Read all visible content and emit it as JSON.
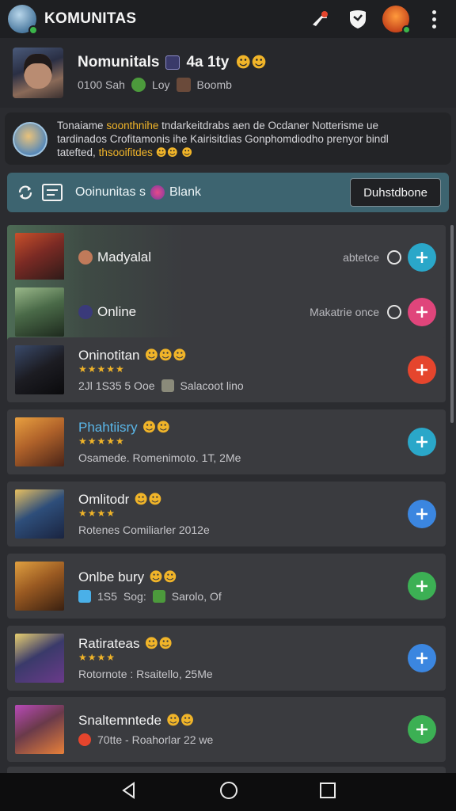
{
  "app": {
    "title": "KOMUNITAS"
  },
  "appbar": {
    "icons": [
      "app-logo",
      "share-icon",
      "shield-icon",
      "user-avatar",
      "more-vertical-icon"
    ]
  },
  "profile": {
    "name": "Nomunitals",
    "name_suffix": "4a 1ty",
    "meta_left": "0100 Sah",
    "meta_mid": "Loy",
    "meta_right": "Boomb"
  },
  "notice": {
    "line1_a": "Tonaiame",
    "line1_hl": "soonthnihe",
    "line1_b": "tndarkeitdrabs aen de Ocdaner Notterisme ue",
    "line2": "tardinados Crofitamonis ihe Kairisitdias Gonphomdiodho prenyor bindl",
    "line3_a": "tatefted,",
    "line3_hl": "thsooifitdes"
  },
  "filter": {
    "label": "Ooinunitas s",
    "label_suffix": "Blank",
    "button": "Duhstdbone"
  },
  "colors": {
    "accent_cyan": "#2aa7c9",
    "accent_pink": "#e0457b",
    "accent_red": "#e5452d",
    "accent_blue": "#3b86e0",
    "accent_green": "#3cb054",
    "star": "#f0b429"
  },
  "rows": [
    {
      "title": "Madyalal",
      "sub": "",
      "status": "abtetce",
      "button_color": "#2aa7c9",
      "thumb": "#7a2a24"
    },
    {
      "title": "Online",
      "sub": "",
      "status": "Makatrie once",
      "button_color": "#e0457b",
      "thumb": "#4a6a48"
    },
    {
      "title": "Oninotitan",
      "stars": "★★★★★",
      "sub_a": "2Jl 1S35 5 Ooe",
      "sub_b": "Salacoot lino",
      "button_color": "#e5452d",
      "thumb": "#1c1c22"
    },
    {
      "title": "Phahtiisry",
      "stars": "★★★★★",
      "sub_a": "Osamede. Romenimoto. 1T, 2Me",
      "button_color": "#2aa7c9",
      "thumb": "#b0622a"
    },
    {
      "title": "Omlitodr",
      "stars": "★★★★",
      "sub_a": "Rotenes Comiliarler 2012e",
      "button_color": "#3b86e0",
      "thumb": "#2e4e7a"
    },
    {
      "title": "Onlbe bury",
      "sub_a": "1S5",
      "sub_b": "Sog:",
      "sub_c": "Sarolo, Of",
      "button_color": "#3cb054",
      "thumb": "#9a5a22"
    },
    {
      "title": "Ratirateas",
      "stars": "★★★★",
      "sub_a": "Rotornote : Rsaitello, 25Me",
      "button_color": "#3b86e0",
      "thumb": "#3a3a6a"
    },
    {
      "title": "Snaltemntede",
      "sub_a": "70tte - Roahorlar 22 we",
      "button_color": "#3cb054",
      "thumb": "#6a3a4a"
    }
  ],
  "navbar": [
    "back-icon",
    "home-icon",
    "recents-icon"
  ]
}
